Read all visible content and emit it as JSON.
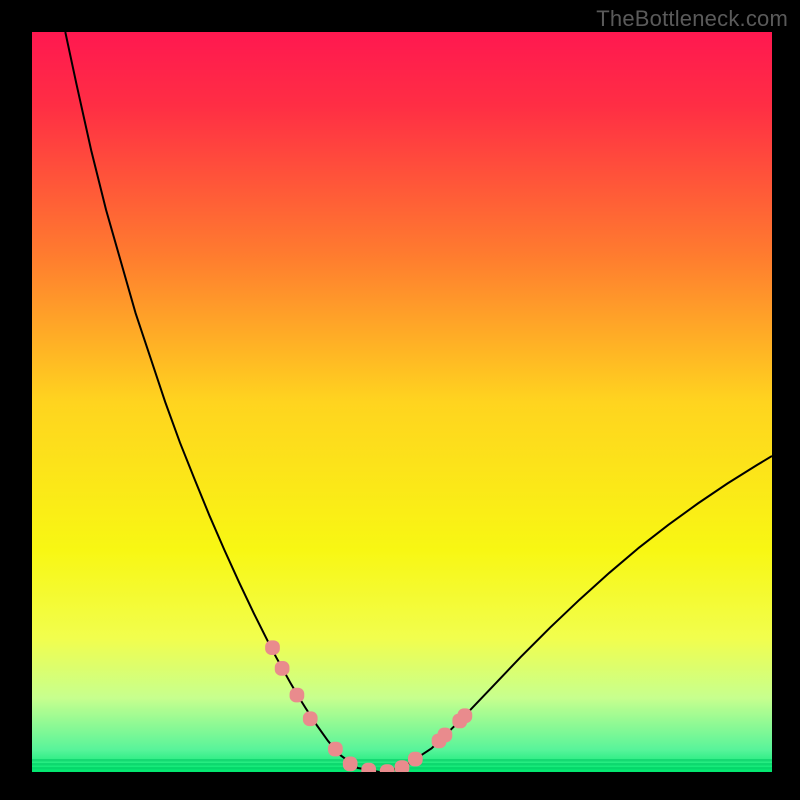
{
  "watermark": "TheBottleneck.com",
  "chart_data": {
    "type": "line",
    "title": "",
    "xlabel": "",
    "ylabel": "",
    "xlim": [
      0,
      100
    ],
    "ylim": [
      0,
      100
    ],
    "gradient_stops": [
      {
        "offset": 0.0,
        "color": "#ff1850"
      },
      {
        "offset": 0.1,
        "color": "#ff2e44"
      },
      {
        "offset": 0.3,
        "color": "#ff7b2f"
      },
      {
        "offset": 0.5,
        "color": "#ffd41f"
      },
      {
        "offset": 0.7,
        "color": "#f8f713"
      },
      {
        "offset": 0.82,
        "color": "#f1fe4e"
      },
      {
        "offset": 0.9,
        "color": "#c7ff8e"
      },
      {
        "offset": 0.97,
        "color": "#58f49a"
      },
      {
        "offset": 1.0,
        "color": "#00e76f"
      }
    ],
    "series": [
      {
        "name": "curve",
        "color": "#000000",
        "stroke_width": 2,
        "x": [
          4.5,
          6,
          8,
          10,
          12,
          14,
          16,
          18,
          20,
          22,
          24,
          26,
          28,
          30,
          32,
          33,
          34,
          35,
          36,
          37,
          38.5,
          40,
          41.5,
          44,
          47,
          50,
          54,
          58,
          62,
          66,
          70,
          74,
          78,
          82,
          86,
          90,
          94,
          98,
          100
        ],
        "y": [
          100,
          93,
          84,
          76,
          69,
          62,
          56,
          50,
          44.5,
          39.5,
          34.6,
          30,
          25.6,
          21.4,
          17.4,
          15.5,
          13.7,
          11.9,
          10.2,
          8.6,
          6.3,
          4.2,
          2.4,
          0.55,
          0,
          0.55,
          3.2,
          7.1,
          11.3,
          15.5,
          19.5,
          23.3,
          26.9,
          30.3,
          33.4,
          36.3,
          39,
          41.5,
          42.7
        ]
      }
    ],
    "highlight": {
      "color": "#e98b8d",
      "radius": 7,
      "points": [
        {
          "x": 32.5,
          "y": 16.8
        },
        {
          "x": 33.8,
          "y": 14.0
        },
        {
          "x": 35.8,
          "y": 10.4
        },
        {
          "x": 37.6,
          "y": 7.2
        },
        {
          "x": 41.0,
          "y": 3.1
        },
        {
          "x": 43.0,
          "y": 1.1
        },
        {
          "x": 45.5,
          "y": 0.25
        },
        {
          "x": 48.0,
          "y": 0.05
        },
        {
          "x": 50.0,
          "y": 0.6
        },
        {
          "x": 51.8,
          "y": 1.75
        },
        {
          "x": 55.0,
          "y": 4.2
        },
        {
          "x": 55.8,
          "y": 5.0
        },
        {
          "x": 57.8,
          "y": 6.9
        },
        {
          "x": 58.5,
          "y": 7.6
        }
      ]
    }
  }
}
